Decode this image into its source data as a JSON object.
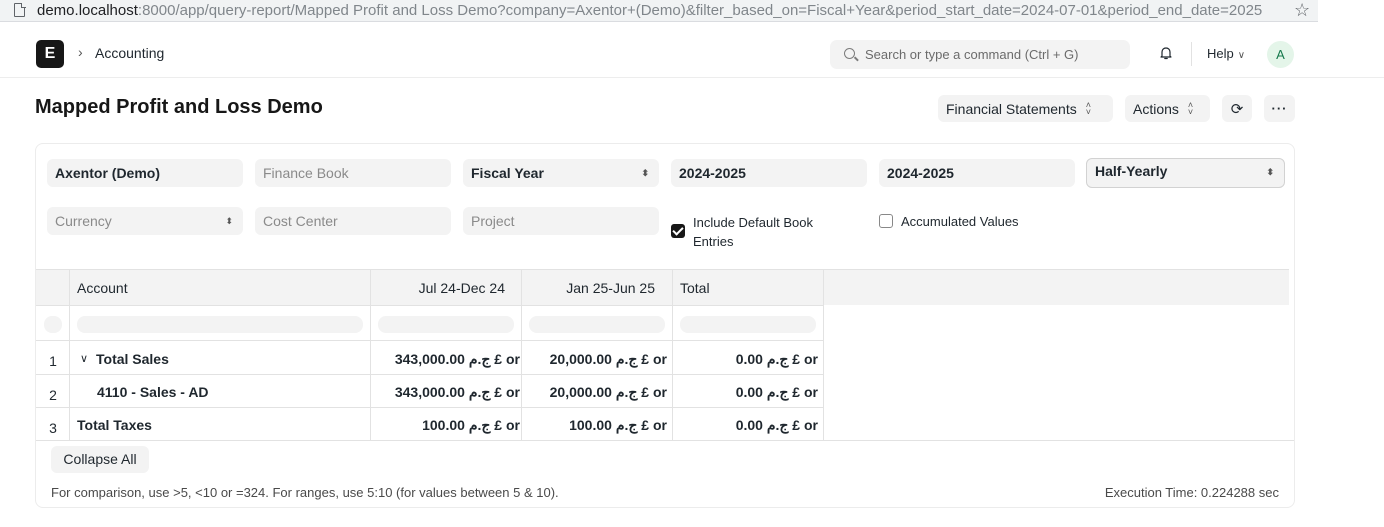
{
  "browser": {
    "url_host": "demo.localhost",
    "url_path": ":8000/app/query-report/Mapped Profit and Loss Demo?company=Axentor+(Demo)&filter_based_on=Fiscal+Year&period_start_date=2024-07-01&period_end_date=2025"
  },
  "navbar": {
    "logo_letter": "E",
    "breadcrumb": "Accounting",
    "search_placeholder": "Search or type a command (Ctrl + G)",
    "help_label": "Help",
    "avatar_letter": "A"
  },
  "page": {
    "title": "Mapped Profit and Loss Demo",
    "financial_statements_label": "Financial Statements",
    "actions_label": "Actions",
    "more_label": "···"
  },
  "filters": {
    "company": "Axentor (Demo)",
    "finance_book_placeholder": "Finance Book",
    "filter_based_on": "Fiscal Year",
    "from_fiscal_year": "2024-2025",
    "to_fiscal_year": "2024-2025",
    "periodicity": "Half-Yearly",
    "currency_placeholder": "Currency",
    "cost_center_placeholder": "Cost Center",
    "project_placeholder": "Project",
    "include_default_book_entries": "Include Default Book Entries",
    "include_default_checked": true,
    "accumulated_values": "Accumulated Values",
    "accumulated_checked": false
  },
  "table": {
    "headers": [
      "Account",
      "Jul 24-Dec 24",
      "Jan 25-Jun 25",
      "Total"
    ],
    "rows": [
      {
        "num": "1",
        "account": "Total Sales",
        "expanded": true,
        "c1": "ج.م 343,000.00 £ or",
        "c2": "ج.م 20,000.00 £ or",
        "total": "ج.م 0.00 £ or"
      },
      {
        "num": "2",
        "account": "4110 - Sales - AD",
        "c1": "ج.م 343,000.00 £ or",
        "c2": "ج.م 20,000.00 £ or",
        "total": "ج.م 0.00 £ or"
      },
      {
        "num": "3",
        "account": "Total Taxes",
        "c1": "ج.م 100.00 £ or",
        "c2": "ج.م 100.00 £ or",
        "total": "ج.م 0.00 £ or"
      }
    ]
  },
  "footer": {
    "collapse_all": "Collapse All",
    "hint": "For comparison, use >5, <10 or =324. For ranges, use 5:10 (for values between 5 & 10).",
    "execution_time": "Execution Time: 0.224288 sec"
  }
}
